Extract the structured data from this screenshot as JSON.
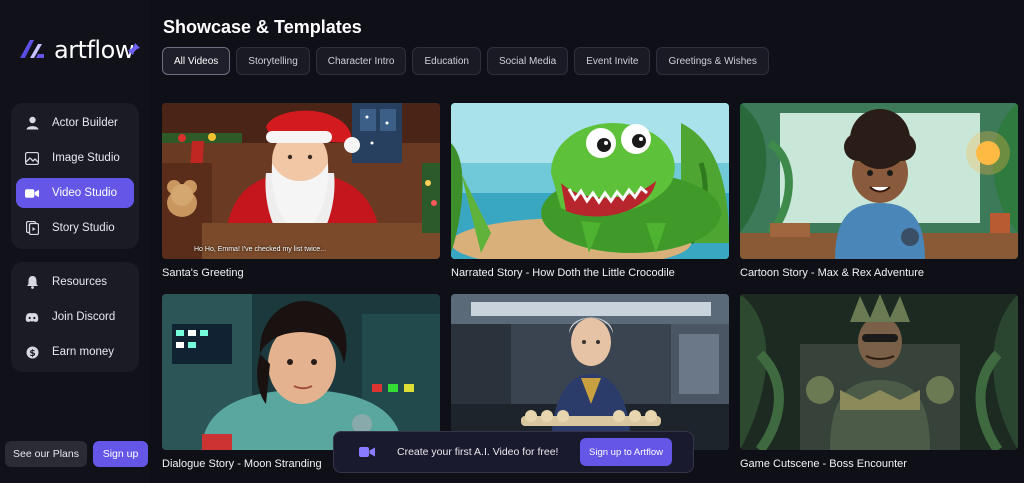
{
  "brand": {
    "name": "artflow"
  },
  "sidebar": {
    "primary": [
      {
        "label": "Actor Builder",
        "icon": "person-icon"
      },
      {
        "label": "Image Studio",
        "icon": "image-icon"
      },
      {
        "label": "Video Studio",
        "icon": "video-camera-icon",
        "active": true
      },
      {
        "label": "Story Studio",
        "icon": "story-icon"
      }
    ],
    "secondary": [
      {
        "label": "Resources",
        "icon": "bell-icon"
      },
      {
        "label": "Join Discord",
        "icon": "discord-icon"
      },
      {
        "label": "Earn money",
        "icon": "dollar-icon"
      }
    ],
    "plans_label": "See our Plans",
    "signup_label": "Sign up"
  },
  "main": {
    "title": "Showcase & Templates",
    "tabs": [
      "All Videos",
      "Storytelling",
      "Character Intro",
      "Education",
      "Social Media",
      "Event Invite",
      "Greetings & Wishes"
    ],
    "cards": [
      {
        "title": "Santa's Greeting",
        "subtitle": "Ho Ho, Emma! I've checked my list twice..."
      },
      {
        "title": "Narrated Story - How Doth the Little Crocodile"
      },
      {
        "title": "Cartoon Story - Max & Rex Adventure"
      },
      {
        "title": "Dialogue Story - Moon Stranding"
      },
      {
        "title": ""
      },
      {
        "title": "Game Cutscene - Boss Encounter"
      }
    ]
  },
  "banner": {
    "text": "Create your first A.I. Video for free!",
    "button": "Sign up to Artflow"
  },
  "colors": {
    "accent": "#6457e8",
    "background": "#0f0f17"
  }
}
